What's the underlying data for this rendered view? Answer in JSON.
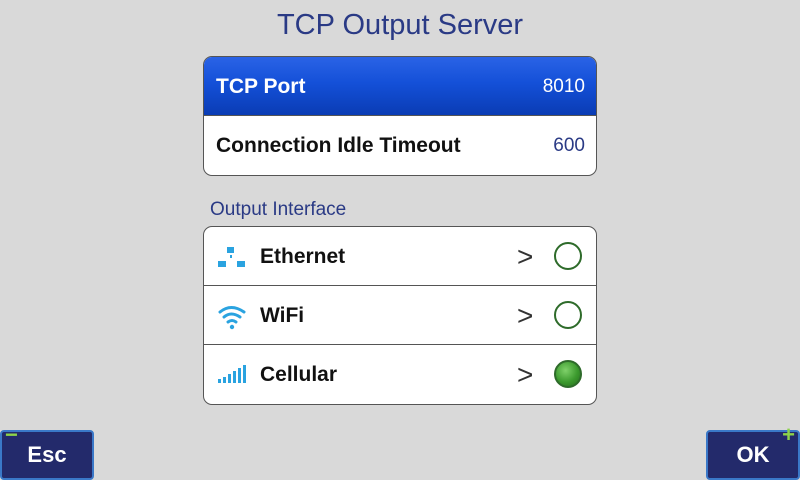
{
  "title": "TCP Output Server",
  "settings": [
    {
      "label": "TCP Port",
      "value": "8010",
      "selected": true
    },
    {
      "label": "Connection Idle Timeout",
      "value": "600",
      "selected": false
    }
  ],
  "output_interface": {
    "label": "Output Interface",
    "items": [
      {
        "label": "Ethernet",
        "icon": "ethernet-icon",
        "chevron": ">",
        "selected": false
      },
      {
        "label": "WiFi",
        "icon": "wifi-icon",
        "chevron": ">",
        "selected": false
      },
      {
        "label": "Cellular",
        "icon": "cellular-signal-icon",
        "chevron": ">",
        "selected": true
      }
    ]
  },
  "softkeys": {
    "left": {
      "label": "Esc",
      "sign": "−"
    },
    "right": {
      "label": "OK",
      "sign": "+"
    }
  },
  "colors": {
    "background": "#d9d9d9",
    "title": "#2a3a85",
    "selected_row": "#1450d8",
    "icon": "#2aa3e0",
    "radio_on": "#3c9a2e",
    "softkey": "#232a6b"
  }
}
